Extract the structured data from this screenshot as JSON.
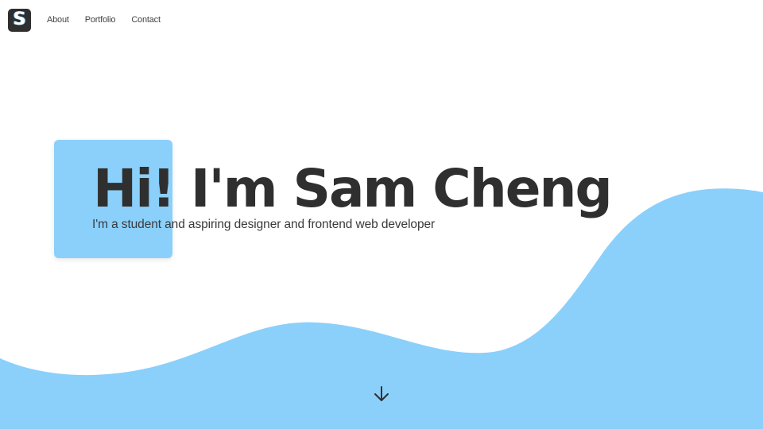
{
  "nav": {
    "logo_letter": "S",
    "links": [
      "About",
      "Portfolio",
      "Contact"
    ]
  },
  "hero": {
    "title": "Hi! I'm Sam Cheng",
    "subtitle": "I'm a student and aspiring designer and frontend web developer"
  },
  "icons": {
    "scroll": "arrow-down-icon"
  },
  "colors": {
    "accent": "#8ad0fb",
    "text": "#2f2f2f",
    "background": "#ffffff"
  }
}
